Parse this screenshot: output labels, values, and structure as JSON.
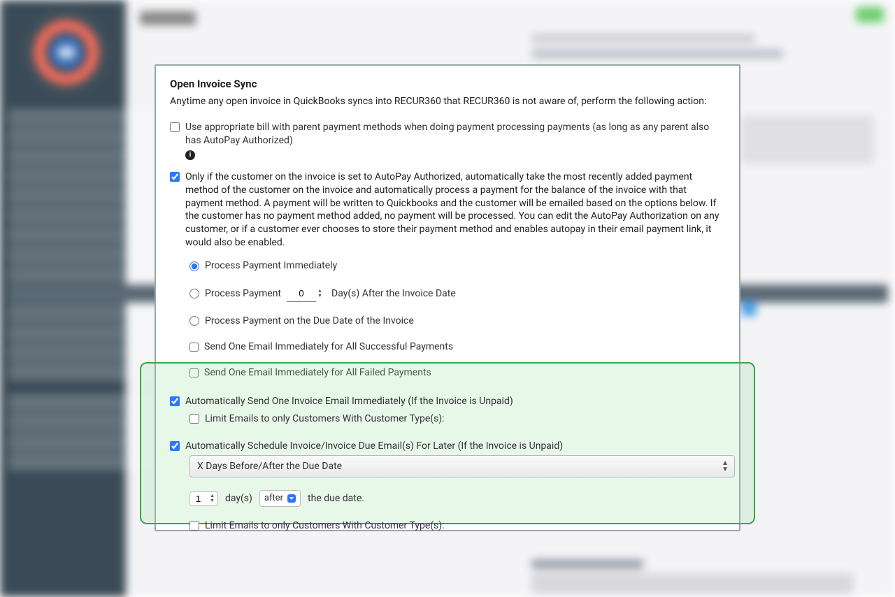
{
  "title": "Open Invoice Sync",
  "intro": "Anytime any open invoice in QuickBooks syncs into RECUR360 that RECUR360 is not aware of, perform the following action:",
  "opt_bill": {
    "label": "Use appropriate bill with parent payment methods when doing payment processing payments (as long as any parent also has AutoPay Authorized)",
    "checked": false
  },
  "opt_autopay": {
    "label": "Only if the customer on the invoice is set to AutoPay Authorized, automatically take the most recently added payment method of the customer on the invoice and automatically process a payment for the balance of the invoice with that payment method. A payment will be written to Quickbooks and the customer will be emailed based on the options below. If the customer has no payment method added, no payment will be processed. You can edit the AutoPay Authorization on any customer, or if a customer ever chooses to store their payment method and enables autopay in their email payment link, it would also be enabled.",
    "checked": true
  },
  "radios": {
    "immediate": "Process Payment Immediately",
    "after_prefix": "Process Payment",
    "after_days": "0",
    "after_suffix": "Day(s) After the Invoice Date",
    "due": "Process Payment on the Due Date of the Invoice",
    "selected": "immediate"
  },
  "chk_success": {
    "label": "Send One Email Immediately for All Successful Payments",
    "checked": false
  },
  "chk_failed": {
    "label": "Send One Email Immediately for All Failed Payments",
    "checked": false
  },
  "chk_auto_send": {
    "label": "Automatically Send One Invoice Email Immediately (If the Invoice is Unpaid)",
    "checked": true
  },
  "chk_limit1": {
    "label": "Limit Emails to only Customers With Customer Type(s):",
    "checked": false
  },
  "chk_schedule": {
    "label": "Automatically Schedule Invoice/Invoice Due Email(s) For Later (If the Invoice is Unpaid)",
    "checked": true
  },
  "select_schedule": "X Days Before/After the Due Date",
  "inline": {
    "days": "1",
    "days_label": "day(s)",
    "rel": "after",
    "suffix": "the due date."
  },
  "chk_limit2": {
    "label": "Limit Emails to only Customers With Customer Type(s):",
    "checked": false
  }
}
